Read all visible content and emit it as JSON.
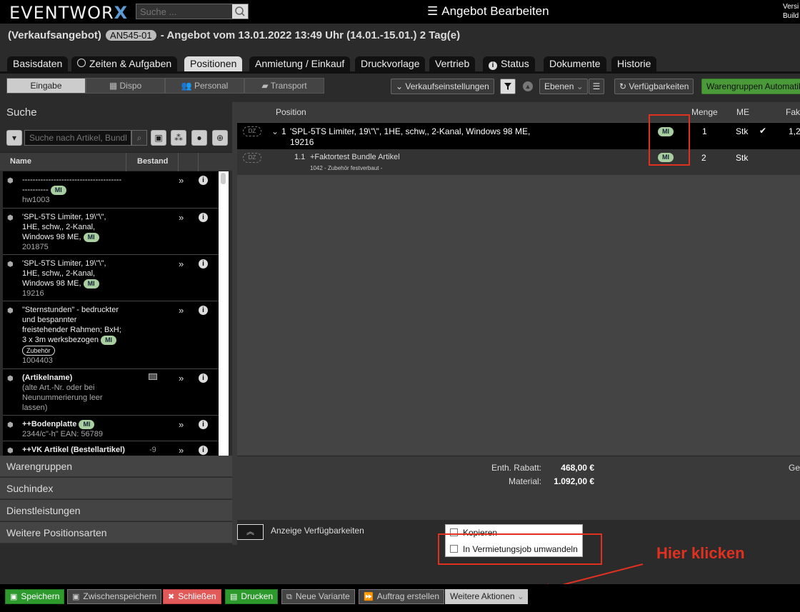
{
  "app": {
    "logo_text": "EVENTWOR",
    "logo_x": "X",
    "title": "Angebot Bearbeiten",
    "version_line1": "Versi",
    "version_line2": "Build"
  },
  "top_search": {
    "placeholder": "Suche ..."
  },
  "header": {
    "prefix": "(Verkaufsangebot)",
    "number": "AN545-01",
    "rest": "- Angebot vom 13.01.2022 13:49 Uhr (14.01.-15.01.) 2 Tag(e)"
  },
  "tabs": [
    "Basisdaten",
    "Zeiten & Aufgaben",
    "Positionen",
    "Anmietung / Einkauf",
    "Druckvorlage",
    "Vertrieb",
    "Status",
    "Dokumente",
    "Historie"
  ],
  "segments": [
    "Eingabe",
    "Dispo",
    "Personal",
    "Transport"
  ],
  "toolbar": {
    "verkaufseinstellungen": "Verkaufseinstellungen",
    "ebenen": "Ebenen",
    "verfuegbarkeiten": "Verfügbarkeiten",
    "warengruppen": "Warengruppen Automatik"
  },
  "left": {
    "title": "Suche",
    "search_placeholder": "Suche nach Artikel, Bundl",
    "col_name": "Name",
    "col_bestand": "Bestand",
    "items": [
      {
        "l1": "--------------------------------------",
        "l2": "----------",
        "badge": "MI",
        "sub": "hw1003"
      },
      {
        "l1": "'SPL-5TS Limiter, 19\\\"\\\",",
        "l2": "1HE, schw,, 2-Kanal,",
        "l3": "Windows 98 ME,",
        "badge": "MI",
        "sub": "201875"
      },
      {
        "l1": "'SPL-5TS Limiter, 19\\\"\\\",",
        "l2": "1HE, schw,, 2-Kanal,",
        "l3": "Windows 98 ME,",
        "badge": "MI",
        "sub": "19216"
      },
      {
        "l1": "\"Sternstunden\" - bedruckter",
        "l2": "und bespannter",
        "l3": "freistehender Rahmen; BxH;",
        "l4": "3 x 3m werksbezogen",
        "badge": "MI",
        "tag": "Zubehör",
        "sub": "1004403"
      },
      {
        "l1": "(Artikelname)",
        "l2": "(alte Art.-Nr. oder bei",
        "l3": "Neunummerierung leer",
        "l4": "lassen)"
      },
      {
        "l1": "++Bodenplatte",
        "badge": "MI",
        "sub": "2344/c\"-h\"  EAN: 56789"
      },
      {
        "l1": "++VK Artikel (Bestellartikel)",
        "stock": "-9"
      }
    ],
    "accordions": [
      "Warengruppen",
      "Suchindex",
      "Dienstleistungen",
      "Weitere Positionsarten"
    ]
  },
  "right": {
    "col_position": "Position",
    "col_menge": "Menge",
    "col_me": "ME",
    "col_fak": "Fak",
    "rows": [
      {
        "dz": "DZ",
        "num": "1",
        "text1": "'SPL-5TS Limiter, 19\\\"\\\", 1HE, schw,, 2-Kanal, Windows 98 ME,",
        "text2": "19216",
        "badge": "MI",
        "menge": "1",
        "me": "Stk",
        "fak": "1,2"
      },
      {
        "dz": "DZ",
        "num": "1.1",
        "text1": "+Faktortest Bundle Artikel",
        "text2": "1042 - Zubehör festverbaut -",
        "badge": "MI",
        "menge": "2",
        "me": "Stk"
      }
    ],
    "footer": {
      "rabatt_label": "Enth. Rabatt:",
      "rabatt_value": "468,00 €",
      "material_label": "Material:",
      "material_value": "1.092,00 €",
      "ge": "Ge"
    },
    "avail_label": "Anzeige Verfügbarkeiten"
  },
  "popup": {
    "item1": "Kopieren",
    "item2": "In Vermietungsjob umwandeln"
  },
  "hint": "Hier klicken",
  "bottom": {
    "speichern": "Speichern",
    "zwischen": "Zwischenspeichern",
    "schliessen": "Schließen",
    "drucken": "Drucken",
    "variante": "Neue Variante",
    "auftrag": "Auftrag erstellen",
    "weitere": "Weitere Aktionen"
  },
  "colors": {
    "accent_green": "#2e9a2e",
    "highlight_red": "#e03020",
    "mi_badge": "#a9cfa0",
    "logo_x": "#5b9bd5"
  }
}
